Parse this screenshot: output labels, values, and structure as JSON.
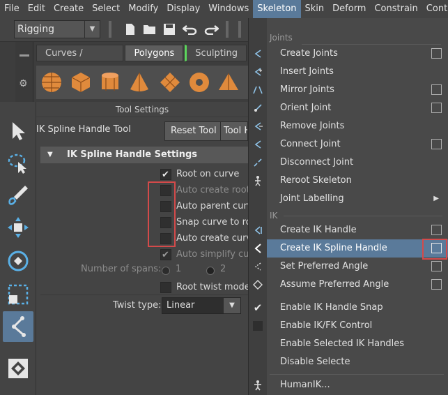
{
  "menubar": [
    "File",
    "Edit",
    "Create",
    "Select",
    "Modify",
    "Display",
    "Windows",
    "Skeleton",
    "Skin",
    "Deform",
    "Constrain",
    "Control"
  ],
  "menubar_active": "Skeleton",
  "mode_select": {
    "value": "Rigging"
  },
  "shelf": {
    "tabs": [
      "Curves / Surfaces",
      "Polygons",
      "Sculpting"
    ],
    "selected_tab": "Polygons",
    "icons": [
      "sphere-icon",
      "cube-icon",
      "cylinder-icon",
      "cone-icon",
      "plane-icon",
      "torus-icon",
      "pyramid-icon"
    ]
  },
  "tool_settings": {
    "panel_title": "Tool Settings",
    "tool_name": "IK Spline Handle Tool",
    "reset_button": "Reset Tool",
    "help_button": "Tool H",
    "section_title": "IK Spline Handle Settings",
    "options": [
      {
        "label": "Root on curve",
        "checked": true,
        "enabled": true
      },
      {
        "label": "Auto create root a",
        "checked": false,
        "enabled": false
      },
      {
        "label": "Auto parent curve",
        "checked": false,
        "enabled": true
      },
      {
        "label": "Snap curve to roo",
        "checked": false,
        "enabled": true
      },
      {
        "label": "Auto create curve",
        "checked": false,
        "enabled": true
      },
      {
        "label": "Auto simplify curv",
        "checked": true,
        "enabled": false
      }
    ],
    "spans_label": "Number of spans:",
    "spans_options": [
      "1",
      "2"
    ],
    "root_twist_label": "Root twist mode",
    "twist_type_label": "Twist type:",
    "twist_type_value": "Linear"
  },
  "skeleton_menu": {
    "groups": {
      "joints": "Joints",
      "ik": "IK"
    },
    "joints_items": [
      {
        "label": "Create Joints",
        "option_box": true
      },
      {
        "label": "Insert Joints",
        "option_box": false
      },
      {
        "label": "Mirror Joints",
        "option_box": true
      },
      {
        "label": "Orient Joint",
        "option_box": true
      },
      {
        "label": "Remove Joints",
        "option_box": false
      },
      {
        "label": "Connect Joint",
        "option_box": true
      },
      {
        "label": "Disconnect Joint",
        "option_box": false
      },
      {
        "label": "Reroot Skeleton",
        "option_box": false
      },
      {
        "label": "Joint Labelling",
        "option_box": false,
        "submenu": true
      }
    ],
    "ik_items": [
      {
        "label": "Create IK Handle",
        "option_box": true
      },
      {
        "label": "Create IK Spline Handle",
        "option_box": true,
        "selected": true
      },
      {
        "label": "Set Preferred Angle",
        "option_box": true
      },
      {
        "label": "Assume Preferred Angle",
        "option_box": true
      },
      {
        "label": "Enable IK Handle Snap",
        "option_box": false,
        "checked": true
      },
      {
        "label": "Enable IK/FK Control",
        "option_box": false
      },
      {
        "label": "Enable Selected IK Handles",
        "option_box": false
      },
      {
        "label": "Disable Selecte",
        "option_box": false
      },
      {
        "label": "HumanIK...",
        "option_box": false
      }
    ]
  },
  "colors": {
    "highlight": "#5a7a9a",
    "callout_red": "#d44a4a",
    "shelf_icon_orange": "#e08a3c"
  }
}
